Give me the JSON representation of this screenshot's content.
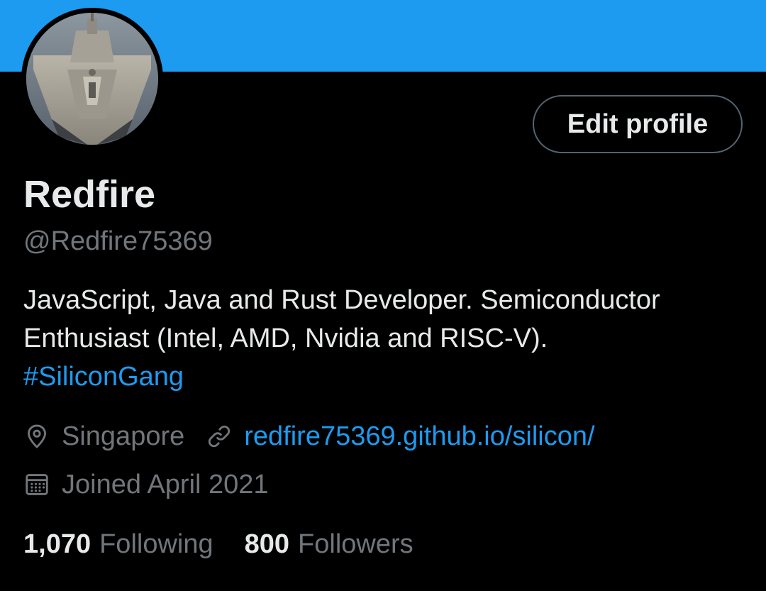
{
  "header": {
    "banner_color": "#1d9bf0",
    "avatar_icon": "ship-avatar-image"
  },
  "actions": {
    "edit_label": "Edit profile"
  },
  "profile": {
    "name": "Redfire",
    "handle": "@Redfire75369",
    "bio_lines": [
      "JavaScript, Java and Rust Developer.  Semiconductor",
      "Enthusiast (Intel, AMD, Nvidia and RISC-V)."
    ],
    "hashtag": "#SiliconGang",
    "location": "Singapore",
    "location_icon": "location-pin-icon",
    "website": "redfire75369.github.io/silicon/",
    "website_icon": "link-icon",
    "joined": "Joined April 2021",
    "joined_icon": "calendar-icon"
  },
  "stats": {
    "following_count": "1,070",
    "following_label": "Following",
    "followers_count": "800",
    "followers_label": "Followers"
  },
  "colors": {
    "background": "#000000",
    "primary_text": "#e7e9ea",
    "secondary_text": "#71767b",
    "accent": "#1d9bf0",
    "button_border": "#536471"
  }
}
